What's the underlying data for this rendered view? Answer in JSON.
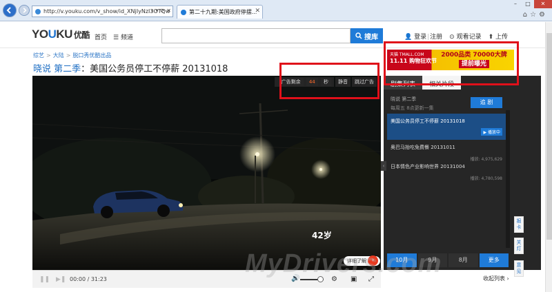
{
  "browser": {
    "url": "http://v.youku.com/v_show/id_XNjIyNzI3OTQw",
    "tab_title": "第二十九期:美国政府停摆..."
  },
  "header": {
    "logo_text": "YOUKU",
    "logo_cn": "优酷",
    "home_label": "首页",
    "channel_label": "频道",
    "search_placeholder": "",
    "search_button": "搜库",
    "login_label": "登录",
    "register_label": "注册",
    "history_label": "观看记录",
    "upload_label": "上传"
  },
  "breadcrumb": [
    "综艺",
    "大陆",
    "脱口秀优酷出品"
  ],
  "title": {
    "show": "晓说 第二季",
    "episode": "美国公务员停工不停薪 20131018"
  },
  "player": {
    "ad_remaining_label": "广告剩余",
    "ad_remaining_count": "44",
    "ad_remaining_unit": "秒",
    "mute_label": "静音",
    "skip_label": "跳过广告",
    "age_tag": "42岁",
    "detail_button": "详细了解",
    "time_display": "00:00 / 31:23",
    "volume_level": 0.85
  },
  "ad_banner": {
    "left_brand": "天猫 TMALL.COM",
    "left_event": "11.11 购物狂欢节",
    "right_line1": "2000品类 70000大牌",
    "right_line2": "提前曝光"
  },
  "right_panel": {
    "tab_playlist": "剧集列表",
    "tab_related": "相关片段",
    "show_name": "晓说 第二季",
    "schedule": "每周五 8点更新一集",
    "follow_button": "追 剧",
    "episodes": [
      {
        "title": "美国公务员停工不停薪 20131018",
        "status": "播放中"
      },
      {
        "title": "奥巴马抬吃免费餐 20131011",
        "status": "播放: 4,975,629"
      },
      {
        "title": "日本情色产业影响世界 20131004",
        "status": "播放: 4,780,598"
      }
    ],
    "months": [
      "10月",
      "9月",
      "8月",
      "更多"
    ],
    "collapse_label": "收起列表"
  },
  "side_float": {
    "report": "报卡",
    "lights": "关灯",
    "feedback": "意见"
  },
  "watermark": "MyDrivers.com"
}
